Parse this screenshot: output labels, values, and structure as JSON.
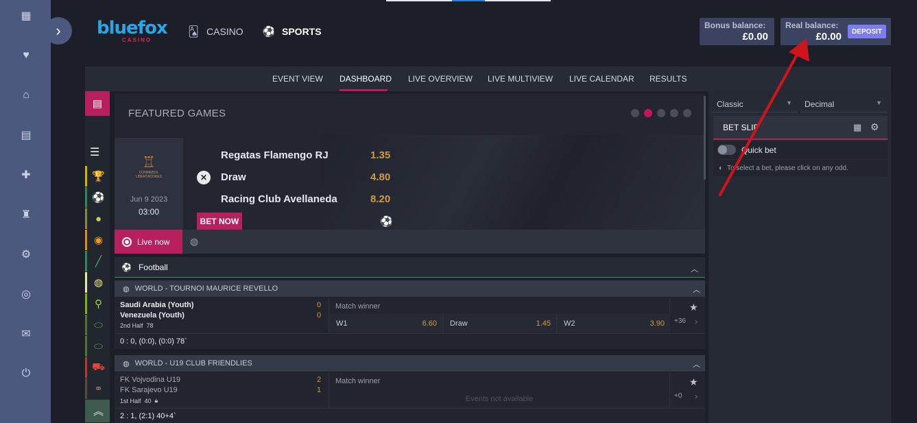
{
  "brand": {
    "name": "bluefox",
    "sub": "CASINO"
  },
  "header": {
    "casino": "CASINO",
    "sports": "SPORTS",
    "bonus_label": "Bonus balance:",
    "bonus_value": "£0.00",
    "real_label": "Real balance:",
    "real_value": "£0.00",
    "deposit": "DEPOSIT"
  },
  "tabs": [
    "EVENT VIEW",
    "DASHBOARD",
    "LIVE OVERVIEW",
    "LIVE MULTIVIEW",
    "LIVE CALENDAR",
    "RESULTS"
  ],
  "featured": {
    "title": "FEATURED GAMES",
    "league_logo_text": "CONMEBOL LIBERTADORES",
    "date": "Jun 9 2023",
    "time": "03:00",
    "teams": [
      "Regatas Flamengo RJ",
      "Draw",
      "Racing Club Avellaneda"
    ],
    "odds": [
      "1.35",
      "4.80",
      "8.20"
    ],
    "bet_now": "BET NOW"
  },
  "live": {
    "label": "Live now"
  },
  "sport": {
    "name": "Football"
  },
  "leagues": [
    {
      "name": "WORLD - TOURNOI MAURICE REVELLO",
      "team1": "Saudi Arabia (Youth)",
      "team2": "Venezuela (Youth)",
      "score1": "0",
      "score2": "0",
      "period": "2nd Half",
      "minute": "78",
      "market": "Match winner",
      "w1_label": "W1",
      "w1": "6.60",
      "draw_label": "Draw",
      "draw": "1.45",
      "w2_label": "W2",
      "w2": "3.90",
      "more": "+36",
      "score_line": "0 : 0, (0:0), (0:0) 78`"
    },
    {
      "name": "WORLD - U19 CLUB FRIENDLIES",
      "team1": "FK Vojvodina U19",
      "team2": "FK Sarajevo U19",
      "score1": "2",
      "score2": "1",
      "period": "1st Half",
      "minute": "40",
      "market": "Match winner",
      "na": "Events not available",
      "more": "+0",
      "score_line": "2 : 1, (2:1) 40+4`"
    }
  ],
  "betslip": {
    "odds_format": "Classic",
    "odds_type": "Decimal",
    "title": "BET SLIP",
    "quick_bet": "Quick bet",
    "hint": "To select a bet, please click on any odd."
  },
  "colors": {
    "accent": "#b8205d",
    "odds": "#d39b3c",
    "rail": "#4d587e",
    "annotation_arrow": "#d0141b"
  },
  "icons": {
    "rail": [
      "dashboard-icon",
      "heart-icon",
      "bank-icon",
      "slot-icon",
      "gift-icon",
      "trophy-icon",
      "settings-icon",
      "target-icon",
      "chat-icon",
      "logout-icon"
    ],
    "sports": [
      "trophy-icon",
      "football-icon",
      "tennis-icon",
      "basketball-icon",
      "hockey-icon",
      "volleyball-icon",
      "table-tennis-icon",
      "rugby-icon",
      "american-football-icon",
      "f1-icon",
      "cycling-icon",
      "scroll-up-icon"
    ]
  }
}
